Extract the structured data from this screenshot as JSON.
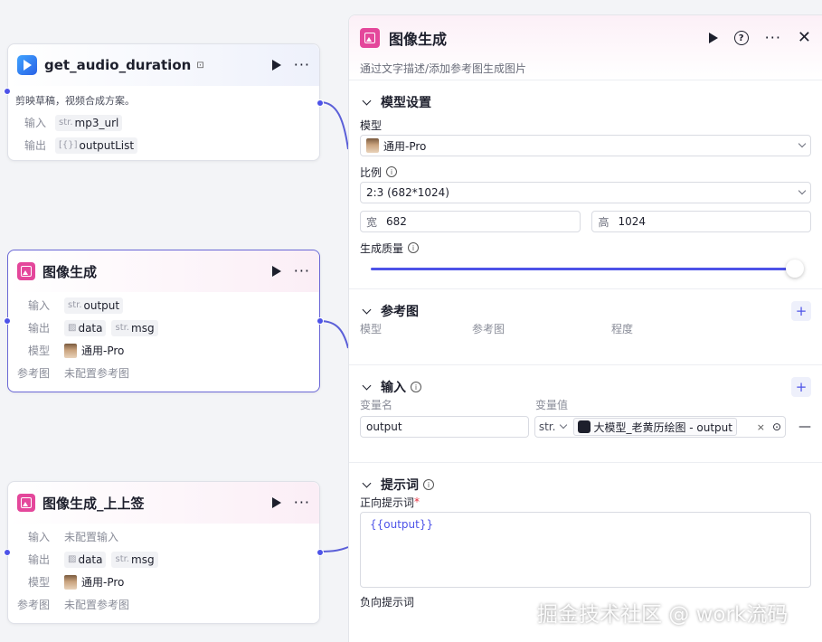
{
  "nodes": {
    "audio": {
      "title": "get_audio_duration",
      "description": "剪映草稿，视频合成方案。",
      "input_label": "输入",
      "input_type": "str.",
      "input_name": "mp3_url",
      "output_label": "输出",
      "output_type": "[{}]",
      "output_name": "outputList"
    },
    "image1": {
      "title": "图像生成",
      "input_label": "输入",
      "input_type": "str.",
      "input_name": "output",
      "output_label": "输出",
      "output_1": "data",
      "output_2_type": "str.",
      "output_2": "msg",
      "model_label": "模型",
      "model_value": "通用-Pro",
      "ref_label": "参考图",
      "ref_value": "未配置参考图"
    },
    "image2": {
      "title": "图像生成_上上签",
      "input_label": "输入",
      "input_value": "未配置输入",
      "output_label": "输出",
      "output_1": "data",
      "output_2_type": "str.",
      "output_2": "msg",
      "model_label": "模型",
      "model_value": "通用-Pro",
      "ref_label": "参考图",
      "ref_value": "未配置参考图"
    }
  },
  "panel": {
    "title": "图像生成",
    "description": "通过文字描述/添加参考图生成图片",
    "model_section": {
      "title": "模型设置",
      "model_label": "模型",
      "model_value": "通用-Pro",
      "ratio_label": "比例",
      "ratio_value": "2:3 (682*1024)",
      "width_prefix": "宽",
      "width_value": "682",
      "height_prefix": "高",
      "height_value": "1024",
      "quality_label": "生成质量",
      "quality_fraction": 1.0
    },
    "ref_section": {
      "title": "参考图",
      "col_model": "模型",
      "col_ref": "参考图",
      "col_degree": "程度"
    },
    "input_section": {
      "title": "输入",
      "col_name": "变量名",
      "col_value": "变量值",
      "var_name": "output",
      "var_type": "str.",
      "var_ref": "大模型_老黄历绘图 - output"
    },
    "prompt_section": {
      "title": "提示词",
      "positive_label": "正向提示词",
      "required_mark": "*",
      "positive_value": "{{output}}",
      "negative_label": "负向提示词"
    }
  },
  "watermark": "掘金技术社区 @ work流码",
  "colors": {
    "accent": "#4d53e8",
    "image_icon": "#e4479b",
    "selected_border": "#6a67d6"
  }
}
